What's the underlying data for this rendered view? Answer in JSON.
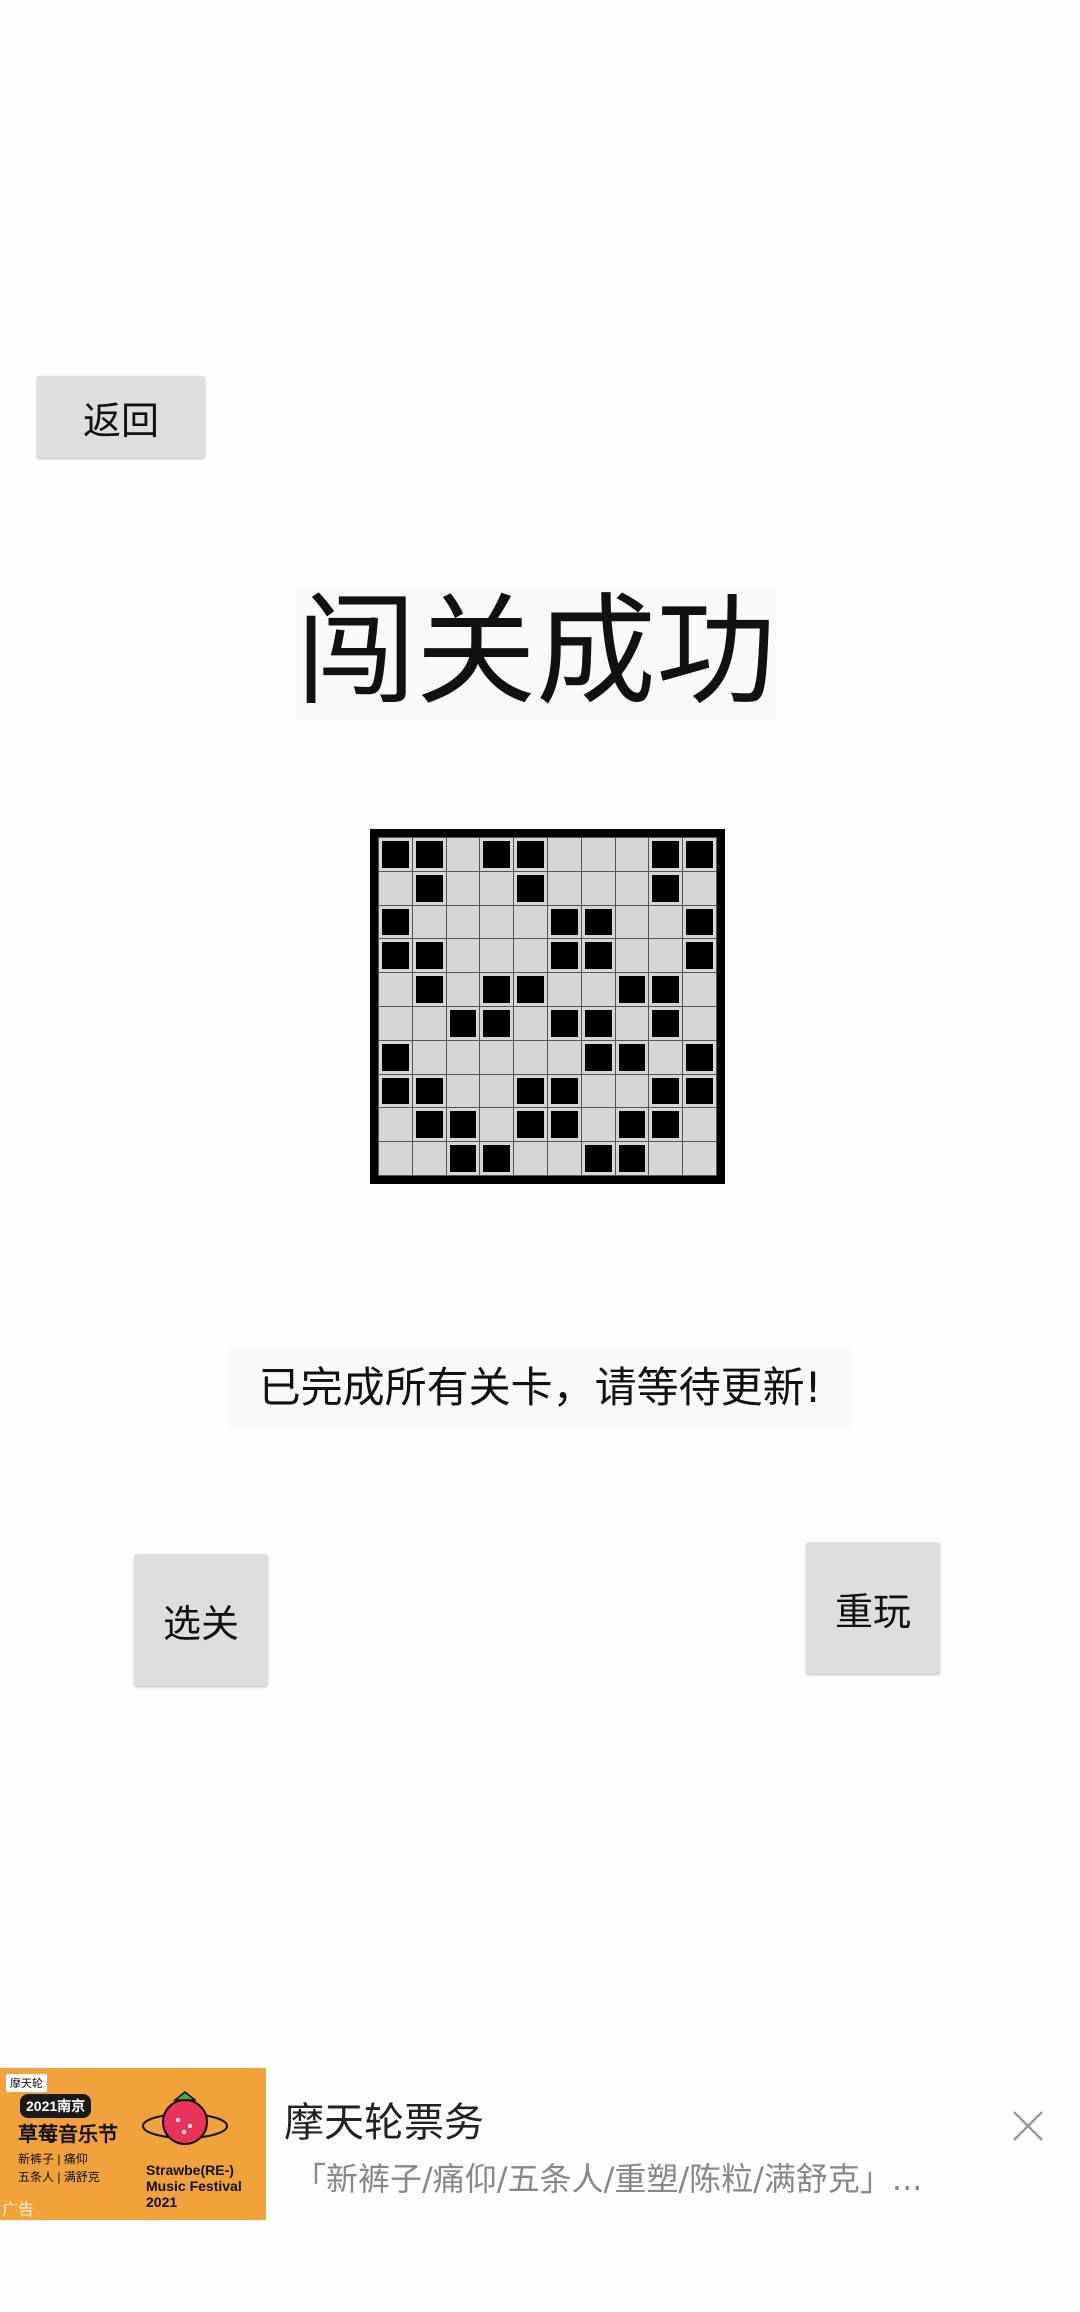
{
  "header": {
    "back_label": "返回"
  },
  "main": {
    "title": "闯关成功",
    "message": "已完成所有关卡，请等待更新!",
    "board": [
      [
        1,
        1,
        0,
        1,
        1,
        0,
        0,
        0,
        1,
        1
      ],
      [
        0,
        1,
        0,
        0,
        1,
        0,
        0,
        0,
        1,
        0
      ],
      [
        1,
        0,
        0,
        0,
        0,
        1,
        1,
        0,
        0,
        1
      ],
      [
        1,
        1,
        0,
        0,
        0,
        1,
        1,
        0,
        0,
        1
      ],
      [
        0,
        1,
        0,
        1,
        1,
        0,
        0,
        1,
        1,
        0
      ],
      [
        0,
        0,
        1,
        1,
        0,
        1,
        1,
        0,
        1,
        0
      ],
      [
        1,
        0,
        0,
        0,
        0,
        0,
        1,
        1,
        0,
        1
      ],
      [
        1,
        1,
        0,
        0,
        1,
        1,
        0,
        0,
        1,
        1
      ],
      [
        0,
        1,
        1,
        0,
        1,
        1,
        0,
        1,
        1,
        0
      ],
      [
        0,
        0,
        1,
        1,
        0,
        0,
        1,
        1,
        0,
        0
      ]
    ]
  },
  "actions": {
    "select_level_label": "选关",
    "replay_label": "重玩"
  },
  "ad": {
    "title": "摩天轮票务",
    "description": "「新裤子/痛仰/五条人/重塑/陈粒/满舒克」...",
    "thumb": {
      "logo": "摩天轮",
      "year_tag": "2021南京",
      "fest_name": "草莓音乐节",
      "artists_line1": "新裤子 | 痛仰",
      "artists_line2": "五条人 | 满舒克",
      "fest_en_line1": "Strawbe(RE-)",
      "fest_en_line2": "Music Festival",
      "fest_en_line3": "2021",
      "ad_tag": "广告"
    }
  }
}
